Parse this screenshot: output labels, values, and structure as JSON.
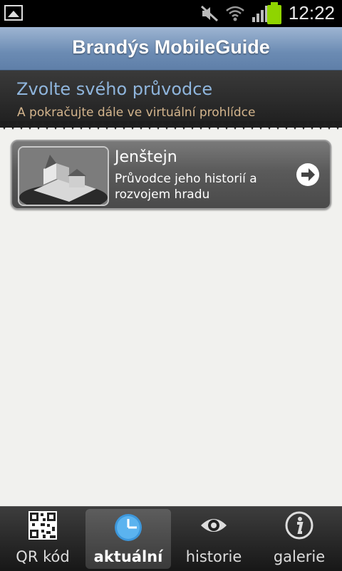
{
  "status_bar": {
    "time": "12:22",
    "icons": [
      "gallery-icon",
      "mute-icon",
      "wifi-icon",
      "signal-icon",
      "battery-icon"
    ],
    "battery_color": "#8fd400"
  },
  "app": {
    "title": "Brandýs MobileGuide",
    "accent": "#8fb5dc"
  },
  "header": {
    "title": "Zvolte svého průvodce",
    "subtitle": "A pokračujte dále ve virtuální prohlídce"
  },
  "guides": [
    {
      "title": "Jenštejn",
      "description": "Průvodce jeho historií a rozvojem hradu",
      "icon": "arrow-right-icon"
    }
  ],
  "tabs": [
    {
      "label": "QR kód",
      "icon": "qr-code-icon",
      "active": false
    },
    {
      "label": "aktuální",
      "icon": "clock-icon",
      "active": true
    },
    {
      "label": "historie",
      "icon": "eye-icon",
      "active": false
    },
    {
      "label": "galerie",
      "icon": "info-icon",
      "active": false
    }
  ]
}
